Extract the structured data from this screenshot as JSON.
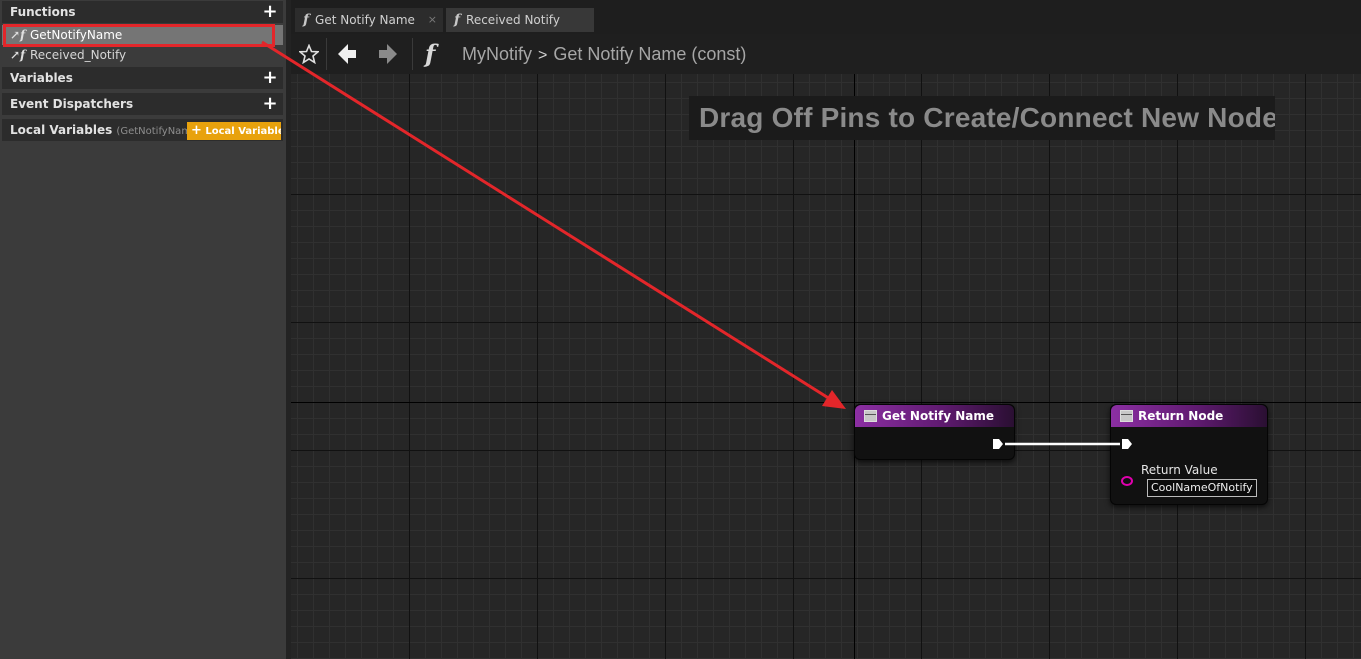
{
  "sidebar": {
    "functions": {
      "header": "Functions",
      "add": "+"
    },
    "items": [
      {
        "label": "GetNotifyName",
        "icon": "function-override-icon",
        "selected": true
      },
      {
        "label": "Received_Notify",
        "icon": "function-override-icon",
        "selected": false
      }
    ],
    "variables": {
      "header": "Variables",
      "add": "+"
    },
    "event_dispatchers": {
      "header": "Event Dispatchers",
      "add": "+"
    },
    "local_variables": {
      "header": "Local Variables",
      "context": "(GetNotifyName",
      "button_plus": "+",
      "button": "Local Variable"
    }
  },
  "tabs": [
    {
      "label": "Get Notify Name",
      "icon": "f",
      "close": "×",
      "active": true
    },
    {
      "label": "Received Notify",
      "icon": "f",
      "close": "×",
      "active": false
    }
  ],
  "toolbar": {
    "icons": [
      "star-icon",
      "back-arrow-icon",
      "forward-arrow-icon"
    ],
    "breadcrumb_icon": "f",
    "breadcrumb_parent": "MyNotify",
    "breadcrumb_separator": ">",
    "breadcrumb_current": "Get Notify Name (const)"
  },
  "graph": {
    "hint": "Drag Off Pins to Create/Connect New Nodes.",
    "nodes": {
      "entry": {
        "title": "Get Notify Name"
      },
      "return": {
        "title": "Return Node",
        "pin_label": "Return Value",
        "pin_value": "CoolNameOfNotify"
      }
    }
  },
  "colors": {
    "highlight": "#e3262a",
    "node_header": "#8c2fa3",
    "name_pin": "#e000ae",
    "local_variable_button": "#e8a20d"
  }
}
